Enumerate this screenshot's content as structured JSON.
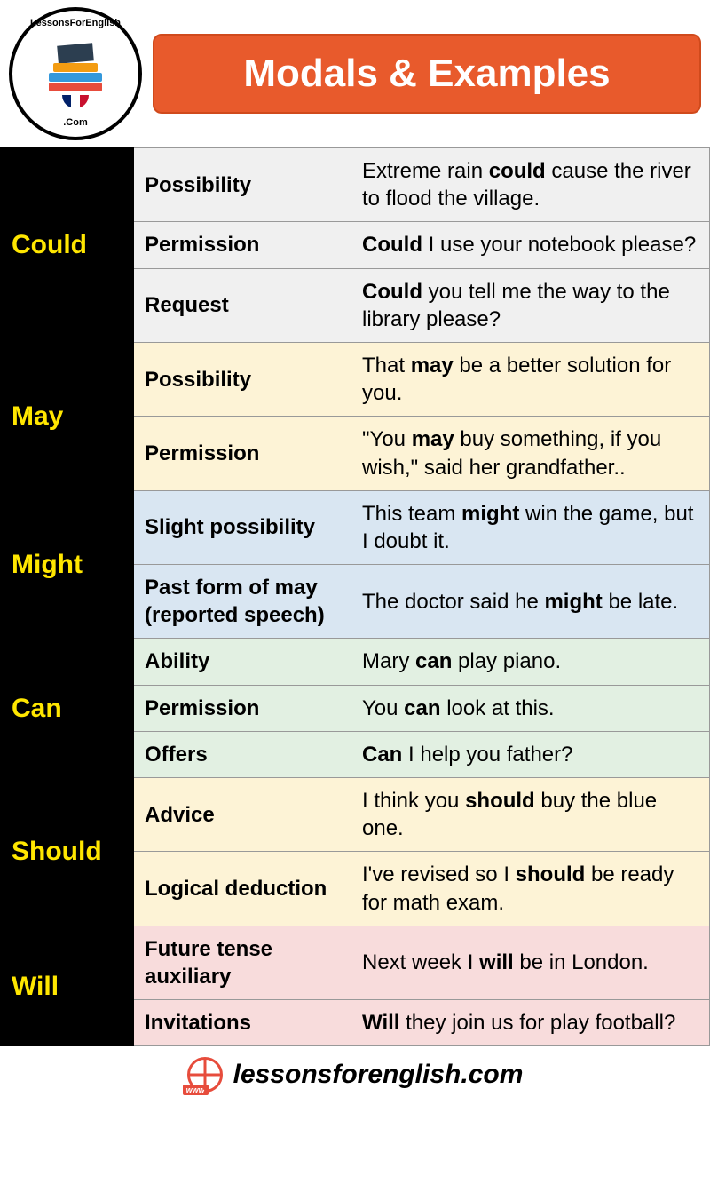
{
  "header": {
    "title": "Modals & Examples",
    "logo_top": "LessonsForEnglish",
    "logo_bottom": ".Com"
  },
  "modals": [
    {
      "name": "Could",
      "bg": "bg-grey",
      "rows": [
        {
          "usage": "Possibility",
          "example_pre": "Extreme rain ",
          "example_bold": "could",
          "example_post": " cause the river to flood the village."
        },
        {
          "usage": "Permission",
          "example_pre": "",
          "example_bold": "Could",
          "example_post": " I use your notebook please?"
        },
        {
          "usage": "Request",
          "example_pre": "",
          "example_bold": "Could",
          "example_post": " you tell me the way to the library please?"
        }
      ]
    },
    {
      "name": "May",
      "bg": "bg-cream",
      "rows": [
        {
          "usage": "Possibility",
          "example_pre": "That ",
          "example_bold": "may",
          "example_post": " be a better solution for you."
        },
        {
          "usage": "Permission",
          "example_pre": "\"You ",
          "example_bold": "may",
          "example_post": " buy something, if you wish,\" said her grandfather.."
        }
      ]
    },
    {
      "name": "Might",
      "bg": "bg-blue",
      "rows": [
        {
          "usage": "Slight possibility",
          "example_pre": "This team ",
          "example_bold": "might",
          "example_post": " win the game, but I doubt it."
        },
        {
          "usage": "Past form of may (reported speech)",
          "example_pre": "The doctor said he ",
          "example_bold": "might",
          "example_post": " be late."
        }
      ]
    },
    {
      "name": "Can",
      "bg": "bg-green",
      "rows": [
        {
          "usage": "Ability",
          "example_pre": "Mary ",
          "example_bold": "can",
          "example_post": " play piano."
        },
        {
          "usage": "Permission",
          "example_pre": "You ",
          "example_bold": "can",
          "example_post": " look at this."
        },
        {
          "usage": "Offers",
          "example_pre": "",
          "example_bold": "Can",
          "example_post": " I help you father?"
        }
      ]
    },
    {
      "name": "Should",
      "bg": "bg-cream",
      "rows": [
        {
          "usage": "Advice",
          "example_pre": "I think you ",
          "example_bold": "should",
          "example_post": " buy the blue one."
        },
        {
          "usage": "Logical deduction",
          "example_pre": "I've revised so I ",
          "example_bold": "should",
          "example_post": " be ready for math exam."
        }
      ]
    },
    {
      "name": "Will",
      "bg": "bg-pink",
      "rows": [
        {
          "usage": "Future tense auxiliary",
          "example_pre": "Next week I ",
          "example_bold": "will",
          "example_post": " be in London."
        },
        {
          "usage": "Invitations",
          "example_pre": "",
          "example_bold": "Will",
          "example_post": " they join us for play football?"
        }
      ]
    }
  ],
  "footer": {
    "url": "lessonsforenglish.com",
    "www": "www"
  }
}
